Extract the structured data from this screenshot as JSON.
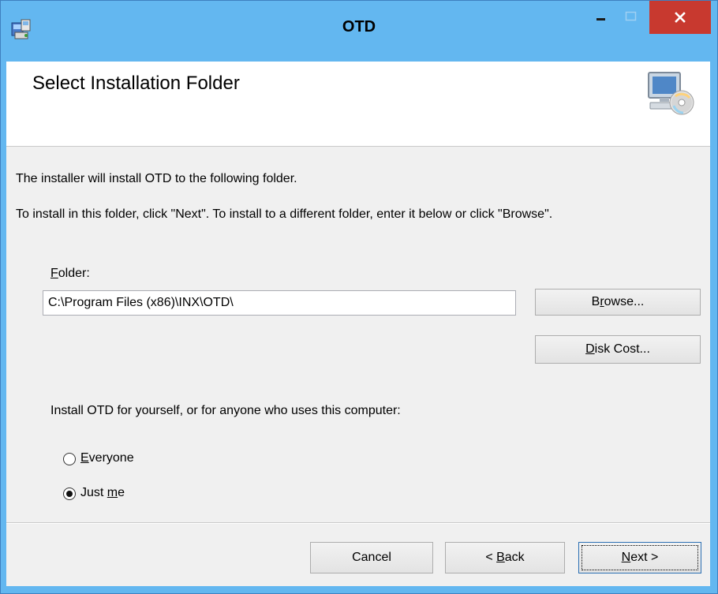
{
  "window": {
    "title": "OTD",
    "icons": {
      "app": "installer-icon",
      "minimize": "minimize-icon",
      "maximize": "maximize-icon",
      "close": "close-icon"
    },
    "colors": {
      "titlebar": "#63b7f0",
      "close": "#c8392f"
    }
  },
  "header": {
    "title": "Select Installation Folder",
    "icon": "computer-cd-icon"
  },
  "body": {
    "intro": "The installer will install OTD to the following folder.",
    "instructions": "To install in this folder, click \"Next\". To install to a different folder, enter it below or click \"Browse\".",
    "folder_label_mnemonic": "F",
    "folder_label_rest": "older:",
    "folder_value": "C:\\Program Files (x86)\\INX\\OTD\\",
    "browse_pre": "B",
    "browse_mnemonic": "r",
    "browse_post": "owse...",
    "diskcost_mnemonic": "D",
    "diskcost_post": "isk Cost...",
    "install_for": "Install OTD for yourself, or for anyone who uses this computer:",
    "everyone_mnemonic": "E",
    "everyone_rest": "veryone",
    "justme_pre": "Just ",
    "justme_mnemonic": "m",
    "justme_post": "e",
    "selected_option": "Just me"
  },
  "footer": {
    "cancel": "Cancel",
    "back_pre": "< ",
    "back_mnemonic": "B",
    "back_post": "ack",
    "next_mnemonic": "N",
    "next_post": "ext >"
  }
}
